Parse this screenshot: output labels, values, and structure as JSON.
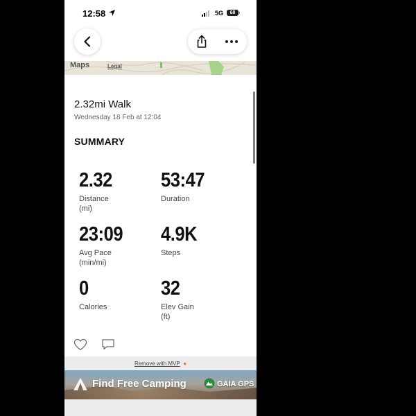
{
  "status_bar": {
    "time": "12:58",
    "network": "5G",
    "battery": "68"
  },
  "map": {
    "attribution": "Maps",
    "legal": "Legal"
  },
  "activity": {
    "title": "2.32mi Walk",
    "date": "Wednesday 18 Feb at 12:04"
  },
  "summary": {
    "title": "SUMMARY",
    "stats": [
      {
        "value": "2.32",
        "label": "Distance (mi)"
      },
      {
        "value": "53:47",
        "label": "Duration"
      },
      {
        "value": "23:09",
        "label": "Avg Pace (min/mi)"
      },
      {
        "value": "4.9K",
        "label": "Steps"
      },
      {
        "value": "0",
        "label": "Calories"
      },
      {
        "value": "32",
        "label": "Elev Gain (ft)"
      }
    ]
  },
  "footer": {
    "remove_ads": "Remove with MVP"
  },
  "ad": {
    "text": "Find Free Camping",
    "brand": "GAIA GPS"
  },
  "icons": {
    "back": "chevron-left-icon",
    "share": "share-icon",
    "more": "more-icon",
    "like": "heart-icon",
    "comment": "comment-icon"
  },
  "colors": {
    "accent": "#f26b21"
  }
}
